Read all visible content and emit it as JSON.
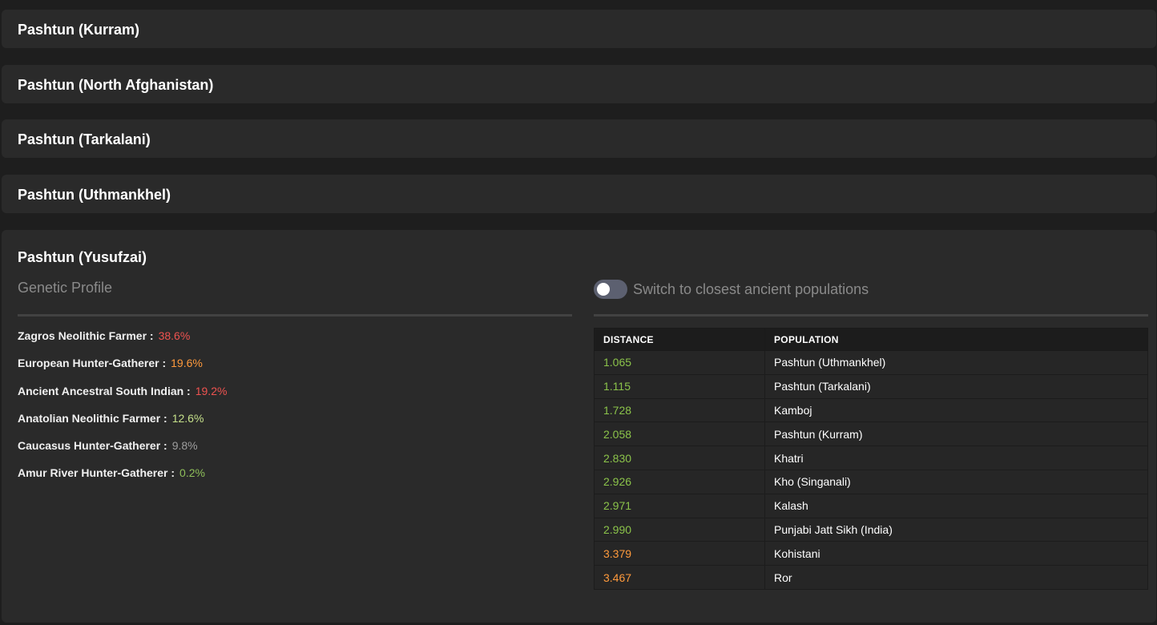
{
  "colors": {
    "red": "#ef5350",
    "orange": "#ff9a3c",
    "green_light": "#c5e08a",
    "green": "#8bc34a",
    "gray": "#9e9e9e",
    "green_muted": "#8fbf5a"
  },
  "panels": [
    {
      "title": "Pashtun (Kurram)"
    },
    {
      "title": "Pashtun (North Afghanistan)"
    },
    {
      "title": "Pashtun (Tarkalani)"
    },
    {
      "title": "Pashtun (Uthmankhel)"
    }
  ],
  "expanded": {
    "title": "Pashtun (Yusufzai)",
    "profile_heading": "Genetic Profile",
    "toggle_label": "Switch to closest ancient populations",
    "toggle_on": false,
    "profile": [
      {
        "label": "Zagros Neolithic Farmer :",
        "value": "38.6%",
        "color": "#ef5350"
      },
      {
        "label": "European Hunter-Gatherer :",
        "value": "19.6%",
        "color": "#ff9a3c"
      },
      {
        "label": "Ancient Ancestral South Indian :",
        "value": "19.2%",
        "color": "#ef5350"
      },
      {
        "label": "Anatolian Neolithic Farmer :",
        "value": "12.6%",
        "color": "#c5e08a"
      },
      {
        "label": "Caucasus Hunter-Gatherer :",
        "value": "9.8%",
        "color": "#9e9e9e"
      },
      {
        "label": "Amur River Hunter-Gatherer :",
        "value": "0.2%",
        "color": "#8fbf5a"
      }
    ],
    "table": {
      "headers": [
        "DISTANCE",
        "POPULATION"
      ],
      "rows": [
        {
          "distance": "1.065",
          "population": "Pashtun (Uthmankhel)",
          "color": "#8bc34a"
        },
        {
          "distance": "1.115",
          "population": "Pashtun (Tarkalani)",
          "color": "#8bc34a"
        },
        {
          "distance": "1.728",
          "population": "Kamboj",
          "color": "#8bc34a"
        },
        {
          "distance": "2.058",
          "population": "Pashtun (Kurram)",
          "color": "#8bc34a"
        },
        {
          "distance": "2.830",
          "population": "Khatri",
          "color": "#8bc34a"
        },
        {
          "distance": "2.926",
          "population": "Kho (Singanali)",
          "color": "#8bc34a"
        },
        {
          "distance": "2.971",
          "population": "Kalash",
          "color": "#8bc34a"
        },
        {
          "distance": "2.990",
          "population": "Punjabi Jatt Sikh (India)",
          "color": "#8bc34a"
        },
        {
          "distance": "3.379",
          "population": "Kohistani",
          "color": "#ff9a3c"
        },
        {
          "distance": "3.467",
          "population": "Ror",
          "color": "#ff9a3c"
        }
      ]
    }
  }
}
